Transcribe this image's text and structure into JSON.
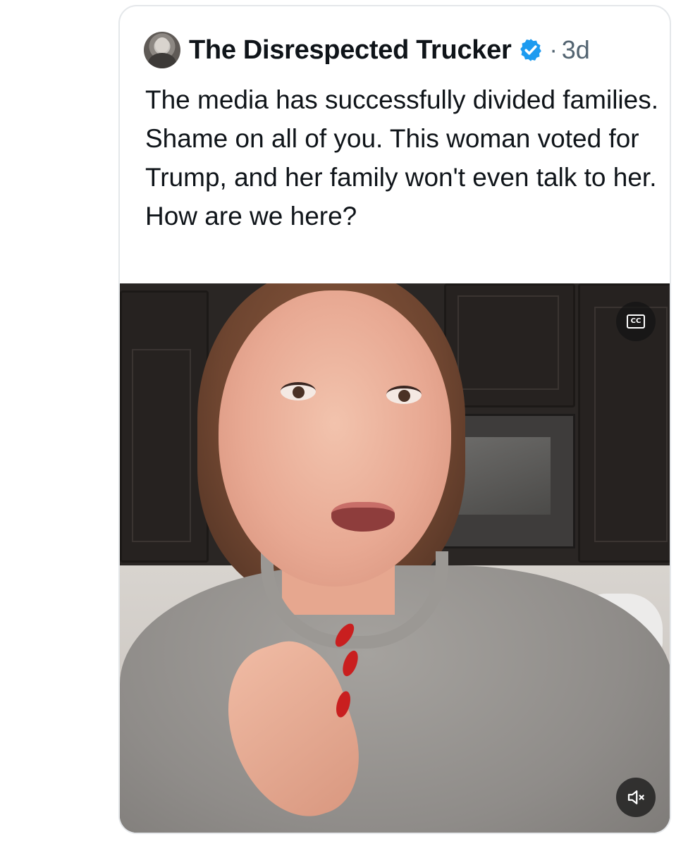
{
  "post": {
    "author": {
      "display_name": "The Disrespected Trucker",
      "verified": true,
      "avatar_icon": "profile-photo-man"
    },
    "separator": "·",
    "timestamp": "3d",
    "text": "The media has successfully divided families. Shame on all of you. This woman voted for Trump, and her family won't even talk to her. How are we here?",
    "media": {
      "type": "video",
      "captions_button_label": "CC",
      "captions_icon": "closed-captions-icon",
      "mute_icon": "speaker-muted-icon"
    }
  },
  "colors": {
    "verified_badge": "#1d9bf0",
    "text_primary": "#0f1419",
    "text_secondary": "#536471",
    "card_border": "#e4e7ea"
  }
}
